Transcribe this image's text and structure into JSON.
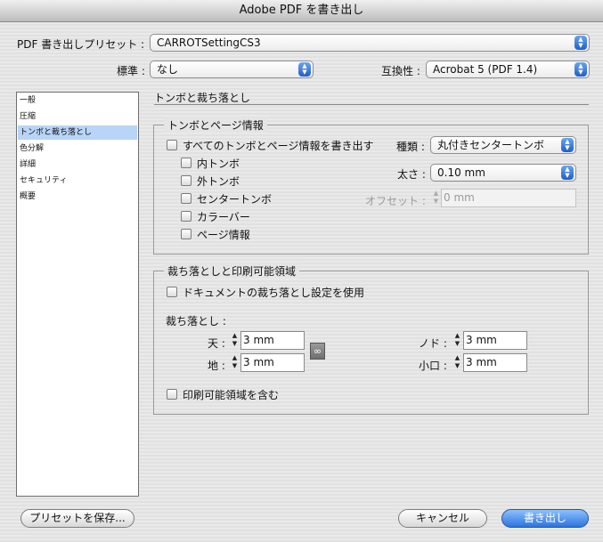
{
  "window": {
    "title": "Adobe PDF を書き出し"
  },
  "preset": {
    "label": "PDF 書き出しプリセット :",
    "value": "CARROTSettingCS3"
  },
  "standard": {
    "label": "標準 :",
    "value": "なし"
  },
  "compatibility": {
    "label": "互換性 :",
    "value": "Acrobat 5 (PDF 1.4)"
  },
  "sidebar": {
    "items": [
      {
        "label": "一般"
      },
      {
        "label": "圧縮"
      },
      {
        "label": "トンボと裁ち落とし",
        "selected": true
      },
      {
        "label": "色分解"
      },
      {
        "label": "詳細"
      },
      {
        "label": "セキュリティ"
      },
      {
        "label": "概要"
      }
    ]
  },
  "main": {
    "section_title": "トンボと裁ち落とし"
  },
  "marks": {
    "group_title": "トンボとページ情報",
    "all_marks": {
      "label": "すべてのトンボとページ情報を書き出す",
      "checked": false
    },
    "items": [
      {
        "label": "内トンボ",
        "checked": false
      },
      {
        "label": "外トンボ",
        "checked": false
      },
      {
        "label": "センタートンボ",
        "checked": false
      },
      {
        "label": "カラーバー",
        "checked": false
      },
      {
        "label": "ページ情報",
        "checked": false
      }
    ],
    "type": {
      "label": "種類 :",
      "value": "丸付きセンタートンボ"
    },
    "weight": {
      "label": "太さ :",
      "value": "0.10 mm"
    },
    "offset": {
      "label": "オフセット :",
      "value": "0 mm"
    }
  },
  "bleed": {
    "group_title": "裁ち落としと印刷可能領域",
    "use_document": {
      "label": "ドキュメントの裁ち落とし設定を使用",
      "checked": false
    },
    "bleed_label": "裁ち落とし :",
    "top": {
      "label": "天 :",
      "value": "3 mm"
    },
    "bottom": {
      "label": "地 :",
      "value": "3 mm"
    },
    "inside": {
      "label": "ノド :",
      "value": "3 mm"
    },
    "outside": {
      "label": "小口 :",
      "value": "3 mm"
    },
    "include_slug": {
      "label": "印刷可能領域を含む",
      "checked": false
    }
  },
  "buttons": {
    "save_preset": "プリセットを保存...",
    "cancel": "キャンセル",
    "export": "書き出し"
  },
  "colors": {
    "selection": "#b8d4f6",
    "accent": "#2c74dd"
  }
}
